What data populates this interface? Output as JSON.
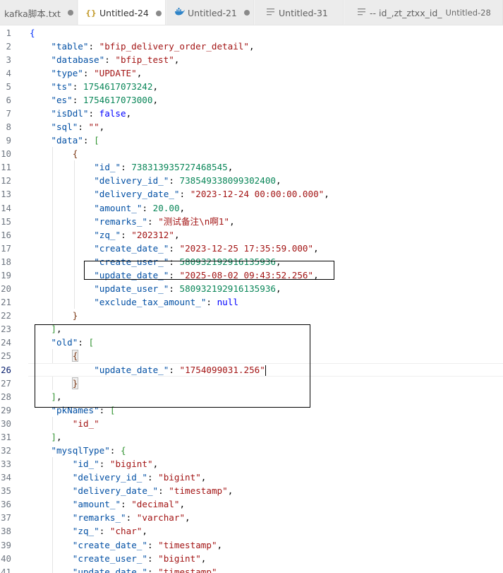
{
  "tabs": [
    {
      "label": "kafka脚本.txt",
      "icon": "none",
      "suffix": "",
      "dirty": true,
      "active": false
    },
    {
      "label": "Untitled-24",
      "icon": "json-braces-icon",
      "suffix": "",
      "dirty": true,
      "active": true
    },
    {
      "label": "Untitled-21",
      "icon": "docker-whale-icon",
      "suffix": "",
      "dirty": true,
      "active": false
    },
    {
      "label": "Untitled-31",
      "icon": "text-lines-icon",
      "suffix": "",
      "dirty": false,
      "active": false
    },
    {
      "label": "-- id_,zt_ztxx_id_",
      "icon": "text-lines-icon",
      "suffix": "Untitled-28",
      "dirty": true,
      "active": false
    }
  ],
  "editor": {
    "current_line": 26,
    "lines": [
      {
        "n": "1",
        "indent": 0,
        "t": [
          [
            "br1",
            "{"
          ]
        ]
      },
      {
        "n": "2",
        "indent": 1,
        "t": [
          [
            "k",
            "\"table\""
          ],
          [
            "p",
            ": "
          ],
          [
            "s",
            "\"bfip_delivery_order_detail\""
          ],
          [
            "p",
            ","
          ]
        ]
      },
      {
        "n": "3",
        "indent": 1,
        "t": [
          [
            "k",
            "\"database\""
          ],
          [
            "p",
            ": "
          ],
          [
            "s",
            "\"bfip_test\""
          ],
          [
            "p",
            ","
          ]
        ]
      },
      {
        "n": "4",
        "indent": 1,
        "t": [
          [
            "k",
            "\"type\""
          ],
          [
            "p",
            ": "
          ],
          [
            "s",
            "\"UPDATE\""
          ],
          [
            "p",
            ","
          ]
        ]
      },
      {
        "n": "5",
        "indent": 1,
        "t": [
          [
            "k",
            "\"ts\""
          ],
          [
            "p",
            ": "
          ],
          [
            "n",
            "1754617073242"
          ],
          [
            "p",
            ","
          ]
        ]
      },
      {
        "n": "6",
        "indent": 1,
        "t": [
          [
            "k",
            "\"es\""
          ],
          [
            "p",
            ": "
          ],
          [
            "n",
            "1754617073000"
          ],
          [
            "p",
            ","
          ]
        ]
      },
      {
        "n": "7",
        "indent": 1,
        "t": [
          [
            "k",
            "\"isDdl\""
          ],
          [
            "p",
            ": "
          ],
          [
            "b",
            "false"
          ],
          [
            "p",
            ","
          ]
        ]
      },
      {
        "n": "8",
        "indent": 1,
        "t": [
          [
            "k",
            "\"sql\""
          ],
          [
            "p",
            ": "
          ],
          [
            "s",
            "\"\""
          ],
          [
            "p",
            ","
          ]
        ]
      },
      {
        "n": "9",
        "indent": 1,
        "t": [
          [
            "k",
            "\"data\""
          ],
          [
            "p",
            ": "
          ],
          [
            "br2",
            "["
          ]
        ]
      },
      {
        "n": "10",
        "indent": 2,
        "t": [
          [
            "br3",
            "{"
          ]
        ]
      },
      {
        "n": "11",
        "indent": 3,
        "t": [
          [
            "k",
            "\"id_\""
          ],
          [
            "p",
            ": "
          ],
          [
            "n",
            "738313935727468545"
          ],
          [
            "p",
            ","
          ]
        ]
      },
      {
        "n": "12",
        "indent": 3,
        "t": [
          [
            "k",
            "\"delivery_id_\""
          ],
          [
            "p",
            ": "
          ],
          [
            "n",
            "738549338099302400"
          ],
          [
            "p",
            ","
          ]
        ]
      },
      {
        "n": "13",
        "indent": 3,
        "t": [
          [
            "k",
            "\"delivery_date_\""
          ],
          [
            "p",
            ": "
          ],
          [
            "s",
            "\"2023-12-24 00:00:00.000\""
          ],
          [
            "p",
            ","
          ]
        ]
      },
      {
        "n": "14",
        "indent": 3,
        "t": [
          [
            "k",
            "\"amount_\""
          ],
          [
            "p",
            ": "
          ],
          [
            "n",
            "20.00"
          ],
          [
            "p",
            ","
          ]
        ]
      },
      {
        "n": "15",
        "indent": 3,
        "t": [
          [
            "k",
            "\"remarks_\""
          ],
          [
            "p",
            ": "
          ],
          [
            "s",
            "\"测试备注\\n啊1\""
          ],
          [
            "p",
            ","
          ]
        ]
      },
      {
        "n": "16",
        "indent": 3,
        "t": [
          [
            "k",
            "\"zq_\""
          ],
          [
            "p",
            ": "
          ],
          [
            "s",
            "\"202312\""
          ],
          [
            "p",
            ","
          ]
        ]
      },
      {
        "n": "17",
        "indent": 3,
        "t": [
          [
            "k",
            "\"create_date_\""
          ],
          [
            "p",
            ": "
          ],
          [
            "s",
            "\"2023-12-25 17:35:59.000\""
          ],
          [
            "p",
            ","
          ]
        ]
      },
      {
        "n": "18",
        "indent": 3,
        "t": [
          [
            "k",
            "\"create_user_\""
          ],
          [
            "p",
            ": "
          ],
          [
            "n",
            "580932192916135936"
          ],
          [
            "p",
            ","
          ]
        ]
      },
      {
        "n": "19",
        "indent": 3,
        "t": [
          [
            "k",
            "\"update_date_\""
          ],
          [
            "p",
            ": "
          ],
          [
            "s",
            "\"2025-08-02 09:43:52.256\""
          ],
          [
            "p",
            ","
          ]
        ]
      },
      {
        "n": "20",
        "indent": 3,
        "t": [
          [
            "k",
            "\"update_user_\""
          ],
          [
            "p",
            ": "
          ],
          [
            "n",
            "580932192916135936"
          ],
          [
            "p",
            ","
          ]
        ]
      },
      {
        "n": "21",
        "indent": 3,
        "t": [
          [
            "k",
            "\"exclude_tax_amount_\""
          ],
          [
            "p",
            ": "
          ],
          [
            "b",
            "null"
          ]
        ]
      },
      {
        "n": "22",
        "indent": 2,
        "t": [
          [
            "br3",
            "}"
          ]
        ]
      },
      {
        "n": "23",
        "indent": 1,
        "t": [
          [
            "br2",
            "]"
          ],
          [
            "p",
            ","
          ]
        ]
      },
      {
        "n": "24",
        "indent": 1,
        "t": [
          [
            "k",
            "\"old\""
          ],
          [
            "p",
            ": "
          ],
          [
            "br2",
            "["
          ]
        ]
      },
      {
        "n": "25",
        "indent": 2,
        "t": [
          [
            "br3",
            "{"
          ]
        ],
        "match": true
      },
      {
        "n": "26",
        "indent": 3,
        "t": [
          [
            "k",
            "\"update_date_\""
          ],
          [
            "p",
            ": "
          ],
          [
            "s",
            "\"1754099031.256\""
          ]
        ],
        "cursor": true
      },
      {
        "n": "27",
        "indent": 2,
        "t": [
          [
            "br3",
            "}"
          ]
        ],
        "match": true
      },
      {
        "n": "28",
        "indent": 1,
        "t": [
          [
            "br2",
            "]"
          ],
          [
            "p",
            ","
          ]
        ]
      },
      {
        "n": "29",
        "indent": 1,
        "t": [
          [
            "k",
            "\"pkNames\""
          ],
          [
            "p",
            ": "
          ],
          [
            "br2",
            "["
          ]
        ]
      },
      {
        "n": "30",
        "indent": 2,
        "t": [
          [
            "s",
            "\"id_\""
          ]
        ]
      },
      {
        "n": "31",
        "indent": 1,
        "t": [
          [
            "br2",
            "]"
          ],
          [
            "p",
            ","
          ]
        ]
      },
      {
        "n": "32",
        "indent": 1,
        "t": [
          [
            "k",
            "\"mysqlType\""
          ],
          [
            "p",
            ": "
          ],
          [
            "br2",
            "{"
          ]
        ]
      },
      {
        "n": "33",
        "indent": 2,
        "t": [
          [
            "k",
            "\"id_\""
          ],
          [
            "p",
            ": "
          ],
          [
            "s",
            "\"bigint\""
          ],
          [
            "p",
            ","
          ]
        ]
      },
      {
        "n": "34",
        "indent": 2,
        "t": [
          [
            "k",
            "\"delivery_id_\""
          ],
          [
            "p",
            ": "
          ],
          [
            "s",
            "\"bigint\""
          ],
          [
            "p",
            ","
          ]
        ]
      },
      {
        "n": "35",
        "indent": 2,
        "t": [
          [
            "k",
            "\"delivery_date_\""
          ],
          [
            "p",
            ": "
          ],
          [
            "s",
            "\"timestamp\""
          ],
          [
            "p",
            ","
          ]
        ]
      },
      {
        "n": "36",
        "indent": 2,
        "t": [
          [
            "k",
            "\"amount_\""
          ],
          [
            "p",
            ": "
          ],
          [
            "s",
            "\"decimal\""
          ],
          [
            "p",
            ","
          ]
        ]
      },
      {
        "n": "37",
        "indent": 2,
        "t": [
          [
            "k",
            "\"remarks_\""
          ],
          [
            "p",
            ": "
          ],
          [
            "s",
            "\"varchar\""
          ],
          [
            "p",
            ","
          ]
        ]
      },
      {
        "n": "38",
        "indent": 2,
        "t": [
          [
            "k",
            "\"zq_\""
          ],
          [
            "p",
            ": "
          ],
          [
            "s",
            "\"char\""
          ],
          [
            "p",
            ","
          ]
        ]
      },
      {
        "n": "39",
        "indent": 2,
        "t": [
          [
            "k",
            "\"create_date_\""
          ],
          [
            "p",
            ": "
          ],
          [
            "s",
            "\"timestamp\""
          ],
          [
            "p",
            ","
          ]
        ]
      },
      {
        "n": "40",
        "indent": 2,
        "t": [
          [
            "k",
            "\"create_user_\""
          ],
          [
            "p",
            ": "
          ],
          [
            "s",
            "\"bigint\""
          ],
          [
            "p",
            ","
          ]
        ]
      },
      {
        "n": "41",
        "indent": 2,
        "t": [
          [
            "k",
            "\"update_date_\""
          ],
          [
            "p",
            ": "
          ],
          [
            "s",
            "\"timestamp\""
          ],
          [
            "p",
            ","
          ]
        ]
      }
    ]
  }
}
